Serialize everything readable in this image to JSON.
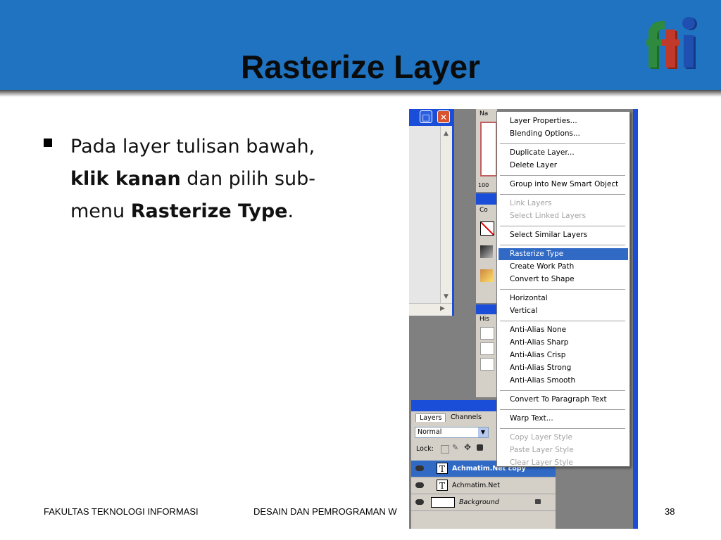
{
  "slide": {
    "title": "Rasterize Layer",
    "bullet": {
      "pre": "Pada layer tulisan bawah,",
      "bold1": "klik kanan",
      "mid": "dan pilih sub-menu",
      "bold2": "Rasterize Type",
      "post": "."
    },
    "footer": {
      "left": "FAKULTAS TEKNOLOGI INFORMASI",
      "center": "DESAIN DAN PEMROGRAMAN W",
      "page": "38"
    },
    "colors": {
      "header": "#1f73c0",
      "highlight": "#316ac5",
      "logo_f": "#2d8a3e",
      "logo_t": "#c0392b",
      "logo_i": "#1f4fb0"
    }
  },
  "screenshot": {
    "panel_tabs": {
      "navigator": "Na",
      "navigator_zoom": "100",
      "color": "Co",
      "history": "His"
    },
    "context_menu": {
      "items": [
        {
          "label": "Layer Properties...",
          "state": "normal"
        },
        {
          "label": "Blending Options...",
          "state": "normal"
        },
        {
          "label": "Duplicate Layer...",
          "state": "normal"
        },
        {
          "label": "Delete Layer",
          "state": "normal"
        },
        {
          "label": "Group into New Smart Object",
          "state": "normal"
        },
        {
          "label": "Link Layers",
          "state": "disabled"
        },
        {
          "label": "Select Linked Layers",
          "state": "disabled"
        },
        {
          "label": "Select Similar Layers",
          "state": "normal"
        },
        {
          "label": "Rasterize Type",
          "state": "highlighted"
        },
        {
          "label": "Create Work Path",
          "state": "normal"
        },
        {
          "label": "Convert to Shape",
          "state": "normal"
        },
        {
          "label": "Horizontal",
          "state": "normal"
        },
        {
          "label": "Vertical",
          "state": "normal"
        },
        {
          "label": "Anti-Alias None",
          "state": "normal"
        },
        {
          "label": "Anti-Alias Sharp",
          "state": "normal"
        },
        {
          "label": "Anti-Alias Crisp",
          "state": "normal"
        },
        {
          "label": "Anti-Alias Strong",
          "state": "normal"
        },
        {
          "label": "Anti-Alias Smooth",
          "state": "normal"
        },
        {
          "label": "Convert To Paragraph Text",
          "state": "normal"
        },
        {
          "label": "Warp Text...",
          "state": "normal"
        },
        {
          "label": "Copy Layer Style",
          "state": "disabled"
        },
        {
          "label": "Paste Layer Style",
          "state": "disabled"
        },
        {
          "label": "Clear Layer Style",
          "state": "disabled"
        }
      ]
    },
    "layers_panel": {
      "tabs": [
        "Layers",
        "Channels"
      ],
      "blend_mode": "Normal",
      "lock_label": "Lock:",
      "layers": [
        {
          "name": "Achmatim.Net copy",
          "type": "text",
          "selected": true
        },
        {
          "name": "Achmatim.Net",
          "type": "text",
          "selected": false
        },
        {
          "name": "Background",
          "type": "image",
          "selected": false,
          "locked": true
        }
      ]
    }
  }
}
